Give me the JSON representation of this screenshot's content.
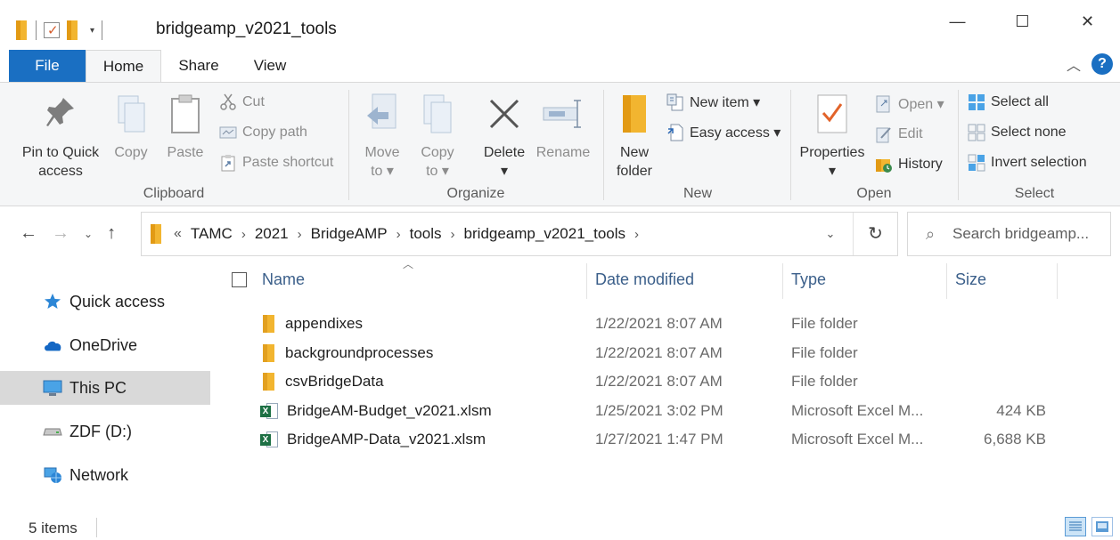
{
  "window": {
    "title": "bridgeamp_v2021_tools",
    "minimize": "—",
    "maximize": "☐",
    "close": "✕"
  },
  "tabs": [
    {
      "label": "File"
    },
    {
      "label": "Home"
    },
    {
      "label": "Share"
    },
    {
      "label": "View"
    }
  ],
  "help": "?",
  "ribbon": {
    "clipboard": {
      "label": "Clipboard",
      "pin": "Pin to Quick access",
      "pin_line1": "Pin to Quick",
      "pin_line2": "access",
      "copy": "Copy",
      "paste": "Paste",
      "cut": "Cut",
      "copy_path": "Copy path",
      "paste_shortcut": "Paste shortcut"
    },
    "organize": {
      "label": "Organize",
      "move_line1": "Move",
      "move_line2": "to ▾",
      "copy_line1": "Copy",
      "copy_line2": "to ▾",
      "delete_line1": "Delete",
      "delete_line2": "▾",
      "rename": "Rename"
    },
    "new": {
      "label": "New",
      "new_folder_line1": "New",
      "new_folder_line2": "folder",
      "new_item": "New item ▾",
      "easy_access": "Easy access ▾"
    },
    "open": {
      "label": "Open",
      "properties_line1": "Properties",
      "properties_line2": "▾",
      "open": "Open ▾",
      "edit": "Edit",
      "history": "History"
    },
    "select": {
      "label": "Select",
      "select_all": "Select all",
      "select_none": "Select none",
      "invert": "Invert selection"
    }
  },
  "address": {
    "overflow": "«",
    "crumbs": [
      "TAMC",
      "2021",
      "BridgeAMP",
      "tools",
      "bridgeamp_v2021_tools"
    ],
    "search_placeholder": "Search bridgeamp..."
  },
  "nav": [
    {
      "label": "Quick access",
      "icon": "star-icon"
    },
    {
      "label": "OneDrive",
      "icon": "cloud-icon"
    },
    {
      "label": "This PC",
      "icon": "computer-icon",
      "selected": true
    },
    {
      "label": "ZDF (D:)",
      "icon": "drive-icon"
    },
    {
      "label": "Network",
      "icon": "network-icon"
    }
  ],
  "columns": {
    "name": "Name",
    "date": "Date modified",
    "type": "Type",
    "size": "Size"
  },
  "files": [
    {
      "name": "appendixes",
      "date": "1/22/2021 8:07 AM",
      "type": "File folder",
      "size": "",
      "icon": "folder-icon"
    },
    {
      "name": "backgroundprocesses",
      "date": "1/22/2021 8:07 AM",
      "type": "File folder",
      "size": "",
      "icon": "folder-icon"
    },
    {
      "name": "csvBridgeData",
      "date": "1/22/2021 8:07 AM",
      "type": "File folder",
      "size": "",
      "icon": "folder-icon"
    },
    {
      "name": "BridgeAM-Budget_v2021.xlsm",
      "date": "1/25/2021 3:02 PM",
      "type": "Microsoft Excel M...",
      "size": "424 KB",
      "icon": "excel-file-icon"
    },
    {
      "name": "BridgeAMP-Data_v2021.xlsm",
      "date": "1/27/2021 1:47 PM",
      "type": "Microsoft Excel M...",
      "size": "6,688 KB",
      "icon": "excel-file-icon"
    }
  ],
  "status": {
    "count": "5 items"
  },
  "colors": {
    "accent": "#1a6fc2",
    "folder": "#f2b530",
    "excel": "#1d7044",
    "selected_nav": "#d9d9d9"
  }
}
